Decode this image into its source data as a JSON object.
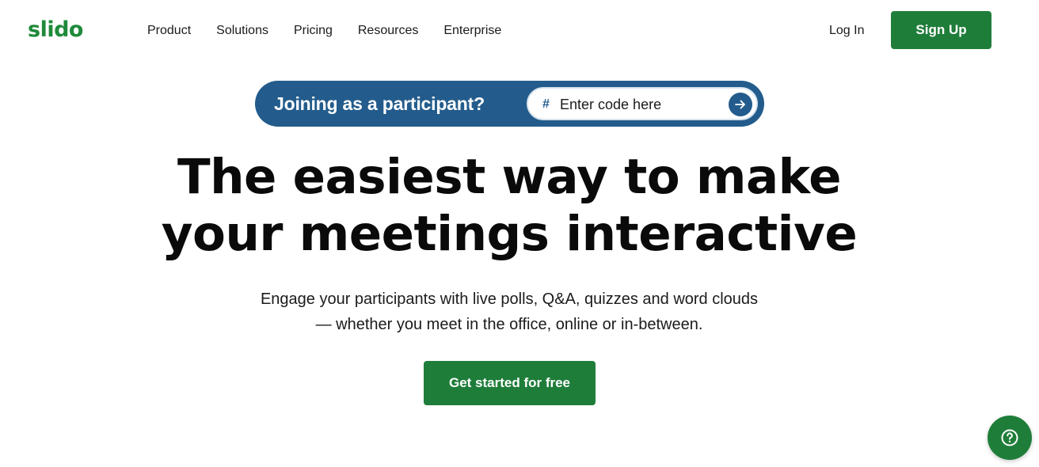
{
  "header": {
    "logo": "slido",
    "nav": [
      "Product",
      "Solutions",
      "Pricing",
      "Resources",
      "Enterprise"
    ],
    "login_label": "Log In",
    "signup_label": "Sign Up"
  },
  "participant": {
    "label": "Joining as a participant?",
    "code_placeholder": "Enter code here",
    "hash_symbol": "#"
  },
  "hero": {
    "headline_line1": "The easiest way to make",
    "headline_line2": "your meetings interactive",
    "subtext_line1": "Engage your participants with live polls, Q&A, quizzes and word clouds",
    "subtext_line2": "— whether you meet in the office, online or in-between.",
    "cta_label": "Get started for free"
  },
  "colors": {
    "brand_green": "#1f7d3a",
    "pill_blue": "#235c8c"
  },
  "icons": {
    "go": "arrow-right-icon",
    "help": "question-circle-icon"
  }
}
